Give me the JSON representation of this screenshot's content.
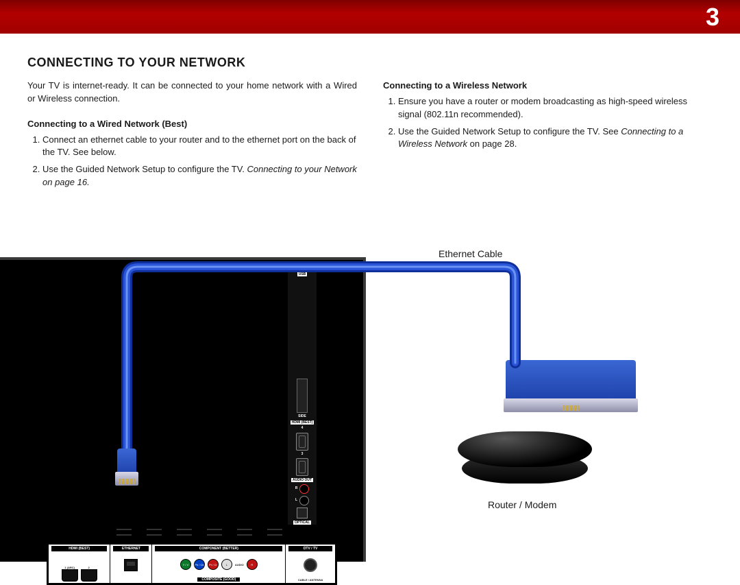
{
  "header": {
    "page_number": "3"
  },
  "section_title": "CONNECTING TO YOUR NETWORK",
  "intro": "Your TV is internet-ready. It can be connected to your home network with a Wired or Wireless connection.",
  "wired": {
    "heading": "Connecting to a Wired Network (Best)",
    "step1": "Connect an ethernet cable to your router and to the ethernet port on the back of the TV. See below.",
    "step2": "Use the Guided Network Setup to configure the TV.",
    "step2_ref": "Connecting to your Network on page 16."
  },
  "wireless": {
    "heading": "Connecting to a Wireless Network",
    "step1": "Ensure you have a router or modem broadcasting as high-speed wireless signal (802.11n recommended).",
    "step2a": "Use the Guided Network Setup to configure the TV. See ",
    "step2_ref": "Connecting to a Wireless Network",
    "step2b": " on page 28."
  },
  "labels": {
    "ethernet_cable": "Ethernet Cable",
    "router_modem": "Router / Modem"
  },
  "side_panel": {
    "usb": "USB",
    "side": "SIDE",
    "hdmi_best": "HDMI\n(BEST)",
    "p4": "4",
    "p3": "3",
    "audio_out": "AUDIO\nOUT",
    "r": "R",
    "l": "L",
    "optical": "OPTICAL"
  },
  "bottom_panel": {
    "hdmi_best": "HDMI (BEST)",
    "arc1": "1\n(ARC)",
    "p2": "2",
    "ethernet": "ETHERNET",
    "component": "COMPONENT (BETTER)",
    "composite": "COMPOSITE (GOOD)",
    "yv": "Y / V",
    "pbcb": "Pb / Cb",
    "prcr": "Pr / Cr",
    "l": "L",
    "audio": "AUDIO",
    "r": "R",
    "dtv": "DTV / TV",
    "cable": "CABLE /\nANTENNA"
  },
  "router": {
    "brand": ""
  },
  "colors": {
    "header_red": "#a00000",
    "cable_blue": "#1d3fa8"
  }
}
